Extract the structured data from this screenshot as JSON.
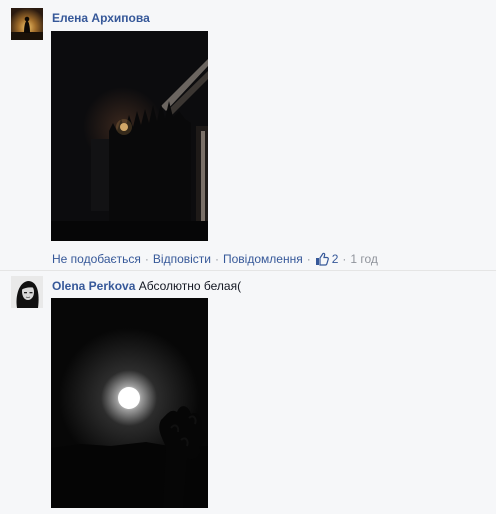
{
  "comments": [
    {
      "author": "Елена Архипова",
      "text": "",
      "actions": {
        "unlike": "Не подобається",
        "reply": "Відповісти",
        "message": "Повідомлення",
        "like_count": "2",
        "time": "1 год"
      }
    },
    {
      "author": "Olena Perkova",
      "text": "Абсолютно белая("
    }
  ],
  "colors": {
    "link": "#365899",
    "meta": "#90949c",
    "background": "#f6f7f9"
  },
  "icons": {
    "like": "thumbs-up-icon",
    "separator": "·"
  }
}
